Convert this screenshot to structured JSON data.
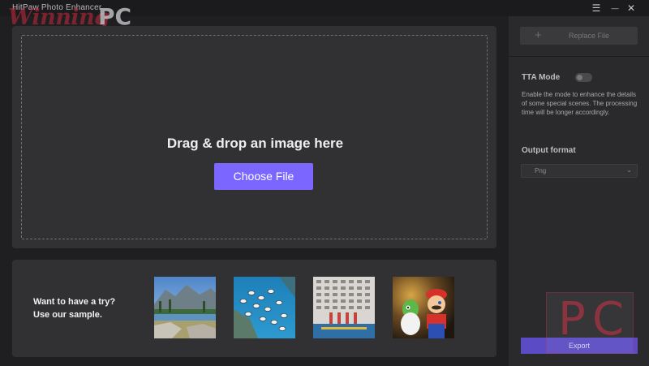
{
  "window": {
    "title": "HitPaw Photo Enhancer",
    "watermark_script": "Winning",
    "watermark_bold": "PC",
    "menu_icon": "☰",
    "minimize_icon": "—",
    "close_icon": "✕"
  },
  "drop_area": {
    "heading": "Drag & drop an image here",
    "button_label": "Choose File"
  },
  "samples": {
    "line1": "Want to have a try?",
    "line2": "Use our sample.",
    "thumbnails": [
      "mountain-lake",
      "fish-school",
      "apartment-building",
      "toy-figures"
    ]
  },
  "side_panel": {
    "replace_plus": "+",
    "replace_label": "Replace File",
    "tta_label": "TTA Mode",
    "tta_enabled": false,
    "tta_description": "Enable the mode to enhance the details of some special scenes. The processing time will be longer accordingly.",
    "output_format_label": "Output format",
    "output_format_value": "Png",
    "dropdown_chevron": "⌄",
    "export_label": "Export",
    "watermark_p": "P",
    "watermark_c": "C"
  },
  "colors": {
    "accent": "#7b67ff",
    "panel": "#313134",
    "background": "#1f1f22"
  }
}
